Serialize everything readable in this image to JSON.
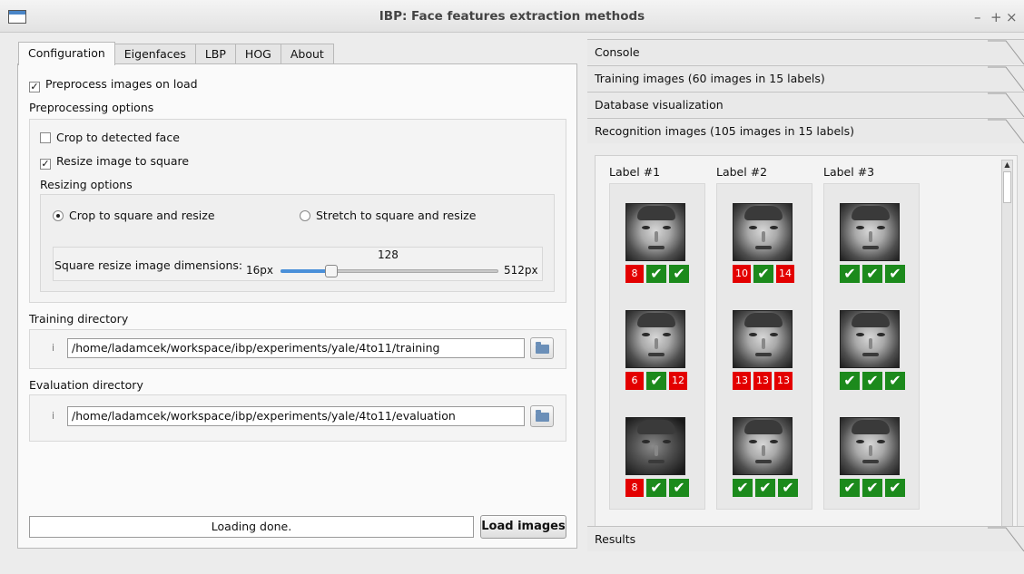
{
  "window": {
    "title": "IBP: Face features extraction methods",
    "controls": [
      "–",
      "+",
      "×"
    ]
  },
  "tabs": [
    "Configuration",
    "Eigenfaces",
    "LBP",
    "HOG",
    "About"
  ],
  "config": {
    "preprocess_label": "Preprocess images on load",
    "preprocess_checked": true,
    "preprocessing_options_title": "Preprocessing options",
    "crop_face_label": "Crop to detected face",
    "crop_face_checked": false,
    "resize_square_label": "Resize image to square",
    "resize_square_checked": true,
    "resizing_options_title": "Resizing options",
    "radio_crop_label": "Crop to square and resize",
    "radio_stretch_label": "Stretch to square and resize",
    "radio_selected": "crop",
    "slider_label": "Square resize image dimensions:",
    "slider_min": "16px",
    "slider_max": "512px",
    "slider_value": "128",
    "slider_fraction": 0.234,
    "training_dir_title": "Training directory",
    "training_dir_value": "/home/ladamcek/workspace/ibp/experiments/yale/4to11/training",
    "evaluation_dir_title": "Evaluation directory",
    "evaluation_dir_value": "/home/ladamcek/workspace/ibp/experiments/yale/4to11/evaluation",
    "info_glyph": "i",
    "status_text": "Loading done.",
    "load_button": "Load images"
  },
  "accordion": {
    "console": "Console",
    "training": "Training images (60 images in 15 labels)",
    "database": "Database visualization",
    "recognition": "Recognition images (105 images in 15 labels)",
    "results": "Results"
  },
  "recognition": {
    "labels": [
      {
        "title": "Label #1",
        "rows": [
          [
            "8",
            "✔",
            "✔"
          ],
          [
            "6",
            "✔",
            "12"
          ],
          [
            "8",
            "✔",
            "✔"
          ]
        ]
      },
      {
        "title": "Label #2",
        "rows": [
          [
            "10",
            "✔",
            "14"
          ],
          [
            "13",
            "13",
            "13"
          ],
          [
            "✔",
            "✔",
            "✔"
          ]
        ]
      },
      {
        "title": "Label #3",
        "rows": [
          [
            "✔",
            "✔",
            "✔"
          ],
          [
            "✔",
            "✔",
            "✔"
          ],
          [
            "✔",
            "✔",
            "✔"
          ]
        ]
      }
    ]
  },
  "colors": {
    "match_green": "#1c8a1c",
    "mismatch_red": "#e30000"
  }
}
